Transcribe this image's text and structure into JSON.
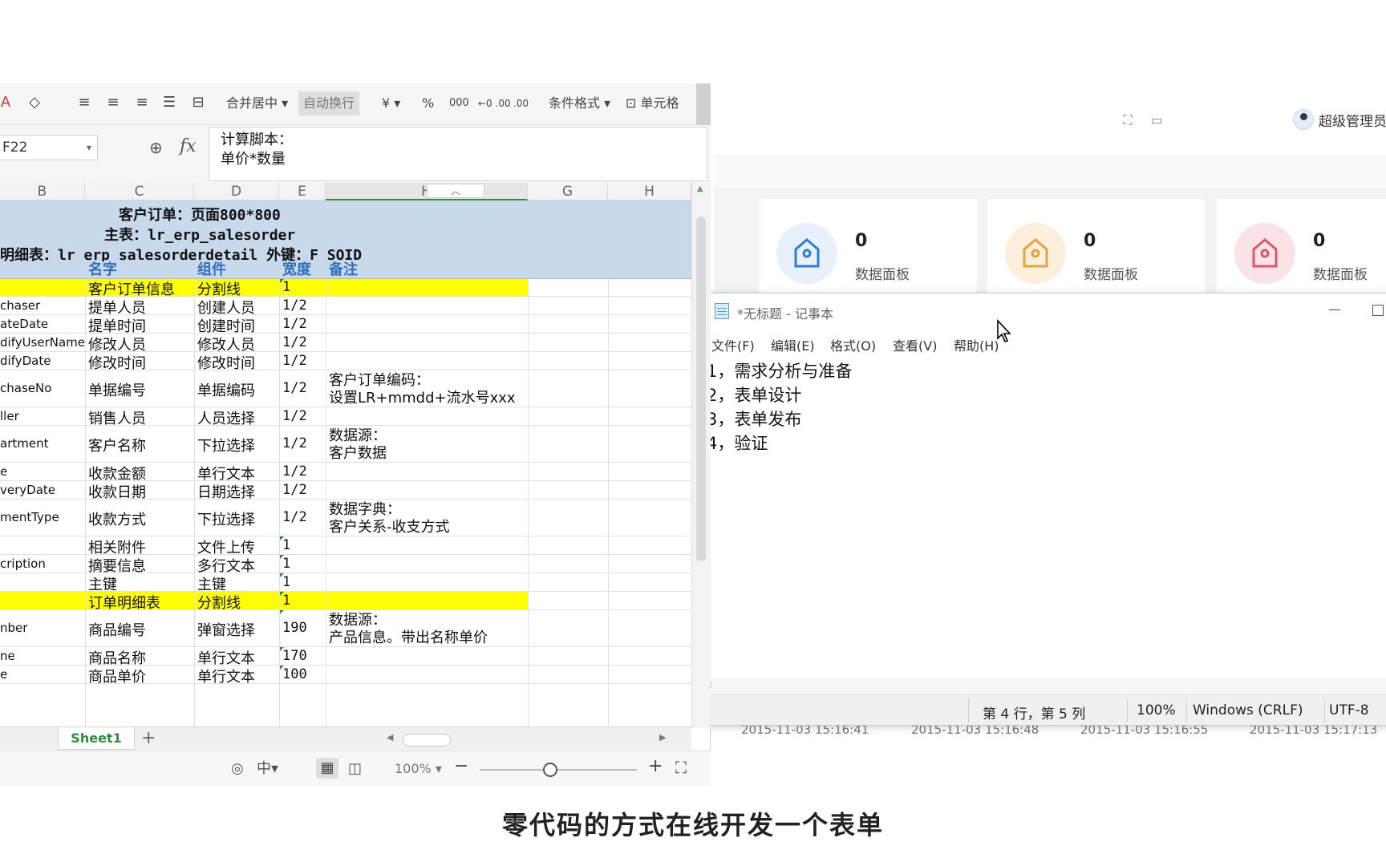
{
  "webapp": {
    "user": {
      "name": "超级管理员"
    },
    "topbar_icons": [
      "fullscreen-icon",
      "message-icon"
    ],
    "cards": [
      {
        "value": "0",
        "label": "数据面板",
        "color": "#2f7bd8",
        "bg": "#e7f0fb"
      },
      {
        "value": "0",
        "label": "数据面板",
        "color": "#e8a33d",
        "bg": "#fcefdc"
      },
      {
        "value": "0",
        "label": "数据面板",
        "color": "#e0556a",
        "bg": "#fbe2e6"
      }
    ],
    "dates": [
      "2015-11-03 15:16:41",
      "2015-11-03 15:16:48",
      "2015-11-03 15:16:55",
      "2015-11-03 15:17:13"
    ]
  },
  "notepad": {
    "title": "*无标题 - 记事本",
    "menu": [
      "文件(F)",
      "编辑(E)",
      "格式(O)",
      "查看(V)",
      "帮助(H)"
    ],
    "lines": [
      "1，需求分析与准备",
      "2，表单设计",
      "3，表单发布",
      "4，验证"
    ],
    "status": {
      "position": "第 4 行，第 5 列",
      "zoom": "100%",
      "line_ending": "Windows (CRLF)",
      "encoding": "UTF-8"
    }
  },
  "spreadsheet": {
    "ribbon": {
      "merge_center": "合并居中",
      "wrap_text": "自动换行",
      "currency": "¥",
      "percent": "%",
      "thousands": "000",
      "inc_decimal": "←0 .00",
      "dec_decimal": ".00 →0",
      "conditional_format": "条件格式",
      "cell_format": "单元格"
    },
    "name_box": "F22",
    "formula_lines": [
      "计算脚本：",
      "单价*数量"
    ],
    "columns": [
      "B",
      "C",
      "D",
      "E",
      "H",
      "G",
      "H"
    ],
    "banner": {
      "line1": "客户订单：页面800*800",
      "line2": "主表：lr_erp_salesorder",
      "line3": "明细表：lr_erp_salesorderdetail 外键：F_SOID"
    },
    "header": {
      "name": "名字",
      "component": "组件",
      "width": "宽度",
      "note": "备注"
    },
    "rows": [
      {
        "b": "",
        "c": "客户订单信息",
        "d": "分割线",
        "e": "1",
        "note1": "",
        "note2": "",
        "yellow": true
      },
      {
        "b": "chaser",
        "c": "提单人员",
        "d": "创建人员",
        "e": "1/2",
        "note1": "",
        "note2": ""
      },
      {
        "b": "ateDate",
        "c": "提单时间",
        "d": "创建时间",
        "e": "1/2",
        "note1": "",
        "note2": ""
      },
      {
        "b": "difyUserName",
        "c": "修改人员",
        "d": "修改人员",
        "e": "1/2",
        "note1": "",
        "note2": ""
      },
      {
        "b": "difyDate",
        "c": "修改时间",
        "d": "修改时间",
        "e": "1/2",
        "note1": "",
        "note2": ""
      },
      {
        "b": "chaseNo",
        "c": "单据编号",
        "d": "单据编码",
        "e": "1/2",
        "note1": "客户订单编码：",
        "note2": "设置LR+mmdd+流水号xxx"
      },
      {
        "b": "ller",
        "c": "销售人员",
        "d": "人员选择",
        "e": "1/2",
        "note1": "",
        "note2": ""
      },
      {
        "b": "artment",
        "c": "客户名称",
        "d": "下拉选择",
        "e": "1/2",
        "note1": "数据源：",
        "note2": "客户数据"
      },
      {
        "b": "e",
        "c": "收款金额",
        "d": "单行文本",
        "e": "1/2",
        "note1": "",
        "note2": ""
      },
      {
        "b": "veryDate",
        "c": "收款日期",
        "d": "日期选择",
        "e": "1/2",
        "note1": "",
        "note2": ""
      },
      {
        "b": "mentType",
        "c": "收款方式",
        "d": "下拉选择",
        "e": "1/2",
        "note1": "数据字典：",
        "note2": "客户关系-收支方式"
      },
      {
        "b": "",
        "c": "相关附件",
        "d": "文件上传",
        "e": "1",
        "note1": "",
        "note2": ""
      },
      {
        "b": "cription",
        "c": "摘要信息",
        "d": "多行文本",
        "e": "1",
        "note1": "",
        "note2": ""
      },
      {
        "b": "",
        "c": "主键",
        "d": "主键",
        "e": "1",
        "note1": "",
        "note2": ""
      },
      {
        "b": "",
        "c": "订单明细表",
        "d": "分割线",
        "e": "1",
        "note1": "",
        "note2": "",
        "yellow": true
      },
      {
        "b": "nber",
        "c": "商品编号",
        "d": "弹窗选择",
        "e": "190",
        "note1": "数据源：",
        "note2": "产品信息。带出名称单价"
      },
      {
        "b": "ne",
        "c": "商品名称",
        "d": "单行文本",
        "e": "170",
        "note1": "",
        "note2": ""
      },
      {
        "b": "e",
        "c": "商品单价",
        "d": "单行文本",
        "e": "100",
        "note1": "",
        "note2": ""
      }
    ],
    "sheet_tab": "Sheet1",
    "add_tab": "+",
    "zoom": "100%",
    "zoom_level": 0.45
  },
  "caption": "零代码的方式在线开发一个表单"
}
